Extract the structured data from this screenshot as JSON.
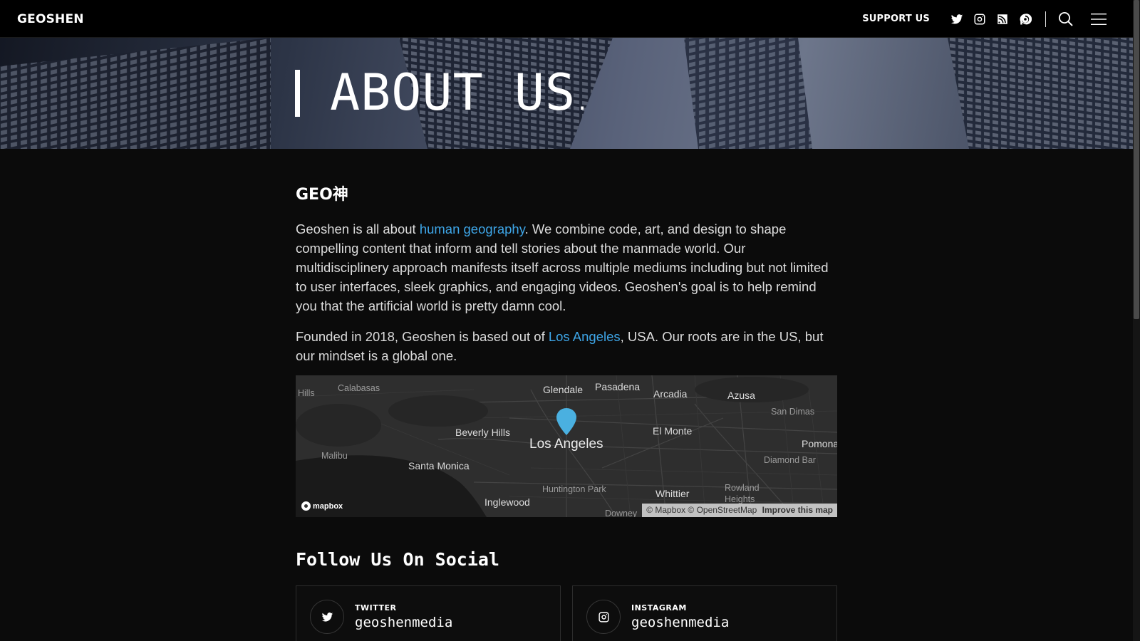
{
  "header": {
    "logo": "GEOSHEN",
    "support_label": "SUPPORT US",
    "icons": [
      "twitter-icon",
      "instagram-icon",
      "rss-icon",
      "patreon-icon",
      "search-icon",
      "menu-icon"
    ]
  },
  "hero": {
    "title": "ABOUT US",
    "title_suffix": "."
  },
  "about": {
    "heading": "GEO神",
    "p1_before": "Geoshen is all about ",
    "p1_link": "human geography",
    "p1_after": ". We combine code, art, and design to shape compelling content that inform and tell stories about the manmade world. Our multidisciplinery approach manifests itself across multiple mediums including but not limited to user interfaces, sleek graphics, and engaging videos. Geoshen's goal is to help remind you that the artificial world is pretty damn cool.",
    "p2_before": "Founded in 2018, Geoshen is based out of ",
    "p2_link": "Los Angeles",
    "p2_after": ", USA. Our roots are in the US, but our mindset is a global one."
  },
  "map": {
    "places": {
      "hills": "Hills",
      "calabasas": "Calabasas",
      "glendale": "Glendale",
      "pasadena": "Pasadena",
      "arcadia": "Arcadia",
      "azusa": "Azusa",
      "san_dimas": "San Dimas",
      "beverly_hills": "Beverly Hills",
      "los_angeles": "Los Angeles",
      "el_monte": "El Monte",
      "pomona": "Pomona",
      "malibu": "Malibu",
      "santa_monica": "Santa Monica",
      "diamond_bar": "Diamond Bar",
      "huntington_park": "Huntington Park",
      "whittier": "Whittier",
      "rowland_heights": "Rowland Heights",
      "inglewood": "Inglewood",
      "downey": "Downey"
    },
    "logo": "mapbox",
    "attribution": "© Mapbox © OpenStreetMap",
    "improve": "Improve this map",
    "pin_color": "#4ab0e0"
  },
  "social": {
    "title": "Follow Us On Social",
    "cards": [
      {
        "label": "TWITTER",
        "handle": "geoshenmedia",
        "icon": "twitter-icon"
      },
      {
        "label": "INSTAGRAM",
        "handle": "geoshenmedia",
        "icon": "instagram-icon"
      }
    ]
  },
  "colors": {
    "link": "#3ea6e8",
    "background": "#0b0b0b",
    "header": "#000000"
  }
}
